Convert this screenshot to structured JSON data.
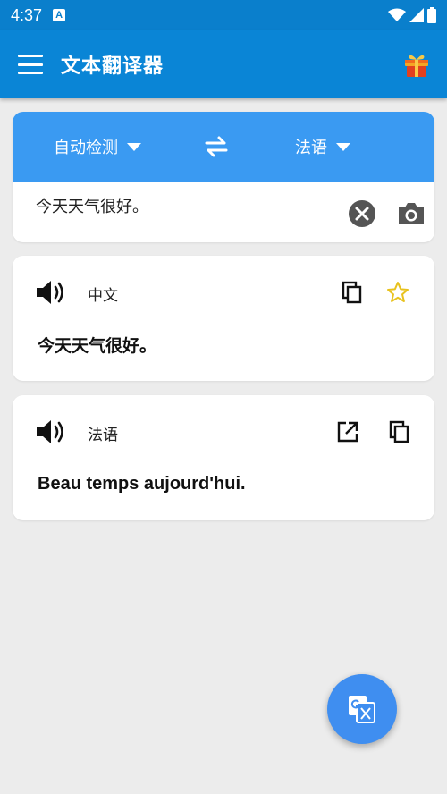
{
  "status_bar": {
    "time": "4:37",
    "notification_badge": "A",
    "icons": [
      "wifi-icon",
      "signal-icon",
      "battery-icon"
    ]
  },
  "app_bar": {
    "title": "文本翻译器",
    "menu_icon": "menu-icon",
    "gift_icon": "gift-icon"
  },
  "input_card": {
    "source_language": "自动检测",
    "target_language": "法语",
    "swap_icon": "swap-icon",
    "input_text": "今天天气很好。",
    "clear_icon": "clear-icon",
    "camera_icon": "camera-icon"
  },
  "results": [
    {
      "language": "中文",
      "text": "今天天气很好。",
      "icons": [
        "speaker-icon",
        "copy-icon",
        "star-icon"
      ]
    },
    {
      "language": "法语",
      "text": "Beau temps aujourd'hui.",
      "icons": [
        "speaker-icon",
        "open-external-icon",
        "copy-icon"
      ]
    }
  ],
  "fab": {
    "icon": "translate-icon"
  },
  "colors": {
    "status_bar": "#0a7fcc",
    "app_bar": "#0a85d6",
    "lang_bar": "#3a9af2",
    "fab": "#3f8ef0",
    "star": "#e8c21e",
    "background": "#ececec"
  }
}
